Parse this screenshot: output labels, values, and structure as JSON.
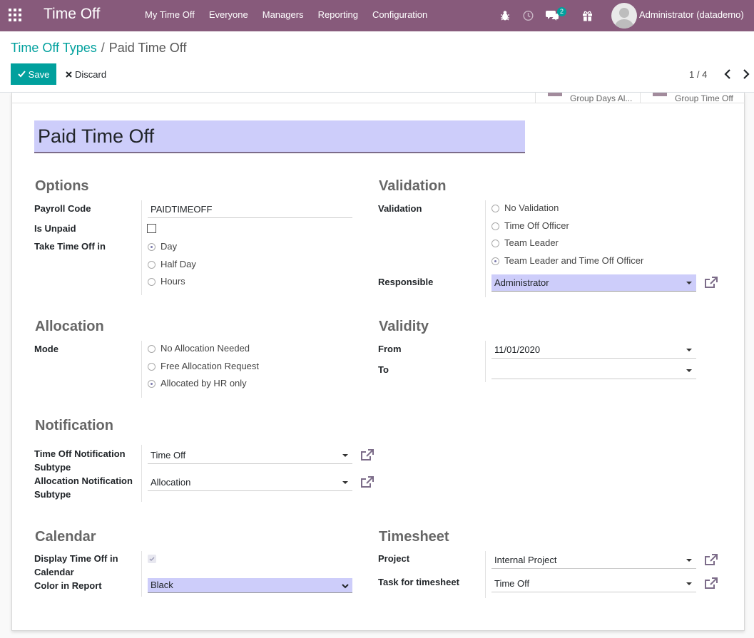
{
  "app": {
    "brand": "Time Off",
    "user": "Administrator (datademo)",
    "chat_badge": "2"
  },
  "menu": [
    "My Time Off",
    "Everyone",
    "Managers",
    "Reporting",
    "Configuration"
  ],
  "breadcrumb": {
    "parent": "Time Off Types",
    "separator": "/",
    "current": "Paid Time Off"
  },
  "actions": {
    "save": "Save",
    "discard": "Discard"
  },
  "pager": {
    "value": "1 / 4"
  },
  "smart_buttons": [
    "Group Days Al...",
    "Group Time Off"
  ],
  "record": {
    "name": "Paid Time Off"
  },
  "options": {
    "title": "Options",
    "payroll_code_label": "Payroll Code",
    "payroll_code": "PAIDTIMEOFF",
    "is_unpaid_label": "Is Unpaid",
    "take_time_off_label": "Take Time Off in",
    "take_time_off": [
      "Day",
      "Half Day",
      "Hours"
    ]
  },
  "validation": {
    "title": "Validation",
    "label": "Validation",
    "choices": [
      "No Validation",
      "Time Off Officer",
      "Team Leader",
      "Team Leader and Time Off Officer"
    ],
    "responsible_label": "Responsible",
    "responsible": "Administrator"
  },
  "allocation": {
    "title": "Allocation",
    "mode_label": "Mode",
    "modes": [
      "No Allocation Needed",
      "Free Allocation Request",
      "Allocated by HR only"
    ]
  },
  "validity": {
    "title": "Validity",
    "from_label": "From",
    "from": "11/01/2020",
    "to_label": "To",
    "to": ""
  },
  "notification": {
    "title": "Notification",
    "timeoff_label": "Time Off Notification Subtype",
    "timeoff_value": "Time Off",
    "allocation_label": "Allocation Notification Subtype",
    "allocation_value": "Allocation"
  },
  "calendar": {
    "title": "Calendar",
    "display_label": "Display Time Off in Calendar",
    "color_label": "Color in Report",
    "color": "Black"
  },
  "timesheet": {
    "title": "Timesheet",
    "project_label": "Project",
    "project": "Internal Project",
    "task_label": "Task for timesheet",
    "task": "Time Off"
  },
  "colors": {
    "navbar": "#875a7b",
    "primary": "#00a09d",
    "highlight": "#cdcdfa"
  }
}
